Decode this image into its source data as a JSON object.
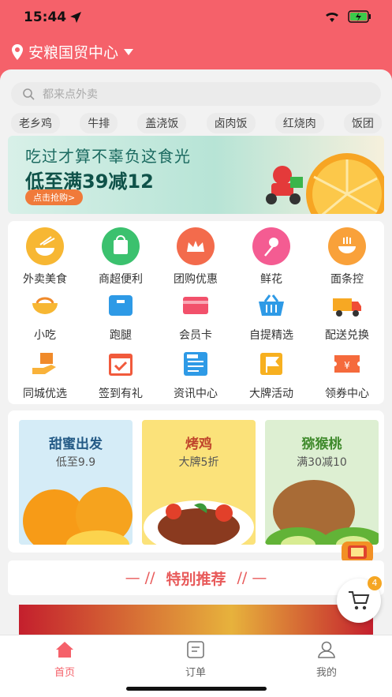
{
  "status": {
    "time": "15:44"
  },
  "header": {
    "location": "安粮国贸中心"
  },
  "search": {
    "placeholder": "都来点外卖"
  },
  "tags": [
    "老乡鸡",
    "牛排",
    "盖浇饭",
    "卤肉饭",
    "红烧肉",
    "饭团"
  ],
  "banner": {
    "line1": "吃过才算不辜负这食光",
    "line2": "低至满39减12",
    "button": "点击抢购>"
  },
  "categories": [
    "外卖美食",
    "商超便利",
    "团购优惠",
    "鲜花",
    "面条控",
    "小吃",
    "跑腿",
    "会员卡",
    "自提精选",
    "配送兑换",
    "同城优选",
    "签到有礼",
    "资讯中心",
    "大牌活动",
    "领券中心"
  ],
  "promos": [
    {
      "title": "甜蜜出发",
      "sub": "低至9.9"
    },
    {
      "title": "烤鸡",
      "sub": "大牌5折"
    },
    {
      "title": "猕猴桃",
      "sub": "满30减10"
    }
  ],
  "recommend": {
    "title": "特别推荐"
  },
  "cart": {
    "count": "4"
  },
  "tabbar": {
    "home": "首页",
    "orders": "订单",
    "mine": "我的"
  },
  "colors": {
    "brand": "#f5616a",
    "accent": "#e85a5a",
    "tab_active": "#f5616a"
  }
}
